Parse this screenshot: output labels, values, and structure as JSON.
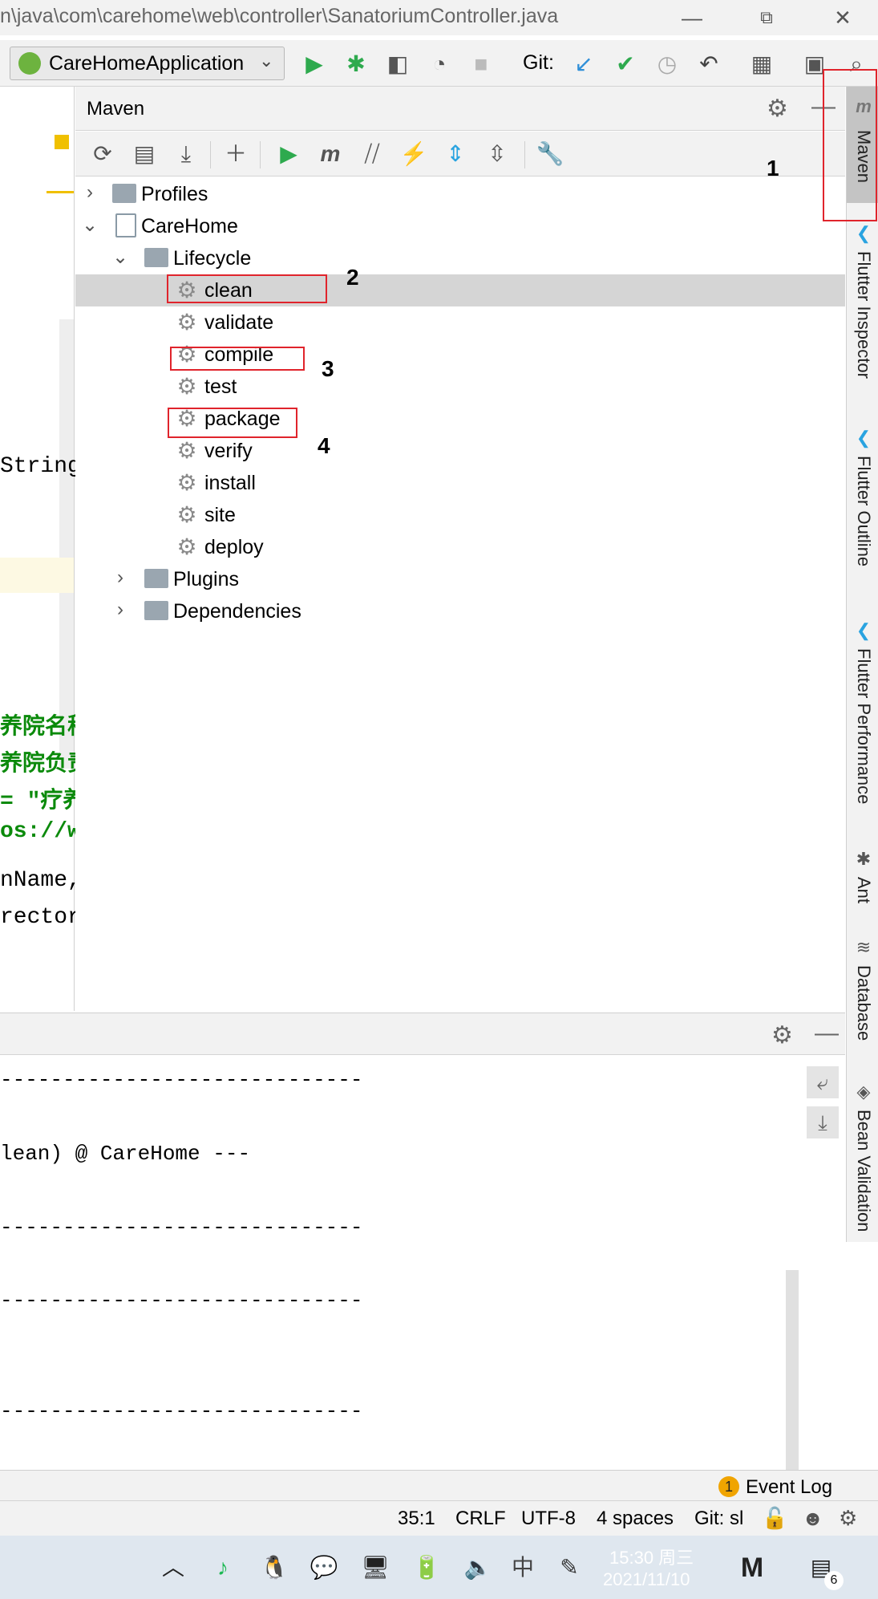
{
  "window": {
    "title_path": "n\\java\\com\\carehome\\web\\controller\\SanatoriumController.java",
    "minimize_glyph": "—",
    "restore_glyph": "⧉",
    "close_glyph": "✕"
  },
  "toolbar": {
    "run_config": "CareHomeApplication",
    "git_label": "Git:"
  },
  "editor": {
    "lines": {
      "string": "String",
      "cn1": "养院名称",
      "cn2": "养院负责",
      "cn3": "= \"疗养",
      "url": "os://ww",
      "name": "nName,",
      "director": "rector_"
    }
  },
  "maven": {
    "title": "Maven",
    "tree": {
      "profiles": "Profiles",
      "project": "CareHome",
      "lifecycle": "Lifecycle",
      "phases": [
        "clean",
        "validate",
        "compile",
        "test",
        "package",
        "verify",
        "install",
        "site",
        "deploy"
      ],
      "plugins": "Plugins",
      "dependencies": "Dependencies"
    },
    "selected_phase": "clean"
  },
  "annotations": [
    "1",
    "2",
    "3",
    "4"
  ],
  "right_tools": [
    "Maven",
    "Flutter Inspector",
    "Flutter Outline",
    "Flutter Performance",
    "Ant",
    "Database",
    "Bean Validation"
  ],
  "run_output": {
    "dashes": "-----------------------------",
    "clean_line": "lean) @ CareHome ---"
  },
  "event_log": {
    "count": "1",
    "label": "Event Log"
  },
  "status": {
    "position": "35:1",
    "line_sep": "CRLF",
    "encoding": "UTF-8",
    "indent": "4 spaces",
    "git": "Git: sl"
  },
  "taskbar": {
    "time": "15:30 周三",
    "date": "2021/11/10",
    "ime": "中",
    "notifications": "6"
  },
  "colors": {
    "accent_red": "#e0242c",
    "run_green": "#2eaa4e",
    "select_gray": "#d5d5d5"
  }
}
